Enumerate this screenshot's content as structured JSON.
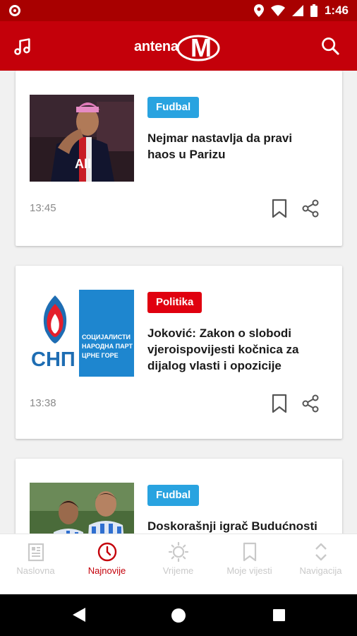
{
  "status_bar": {
    "time": "1:46",
    "icons": [
      "location-icon",
      "wifi-icon",
      "signal-icon",
      "battery-icon"
    ]
  },
  "app_bar": {
    "logo_text": "antena",
    "logo_mark": "M",
    "left_icon": "music-icon",
    "right_icon": "search-icon"
  },
  "colors": {
    "brand": "#c4000a",
    "fudbal": "#29a3e0",
    "politika": "#e0000f"
  },
  "articles": [
    {
      "category": "Fudbal",
      "category_color": "#29a3e0",
      "title": "Nejmar nastavlja da pravi haos u Parizu",
      "time": "13:45"
    },
    {
      "category": "Politika",
      "category_color": "#e0000f",
      "title": "Joković: Zakon o slobodi vjeroispovijesti kočnica za dijalog vlasti i opozicije",
      "time": "13:38",
      "thumb_text": {
        "logo": "СНП",
        "line1": "СОЦИЈАЛИСТИ",
        "line2": "НАРОДНА ПАРТ",
        "line3": "ЦРНЕ ГОРЕ"
      }
    },
    {
      "category": "Fudbal",
      "category_color": "#29a3e0",
      "title": "Doskorašnji igrač Budućnosti",
      "time": ""
    }
  ],
  "bottom_nav": [
    {
      "label": "Naslovna",
      "icon": "newspaper-icon",
      "active": false
    },
    {
      "label": "Najnovije",
      "icon": "clock-icon",
      "active": true
    },
    {
      "label": "Vrijeme",
      "icon": "sun-icon",
      "active": false
    },
    {
      "label": "Moje vijesti",
      "icon": "bookmark-icon",
      "active": false
    },
    {
      "label": "Navigacija",
      "icon": "chevrons-icon",
      "active": false
    }
  ]
}
